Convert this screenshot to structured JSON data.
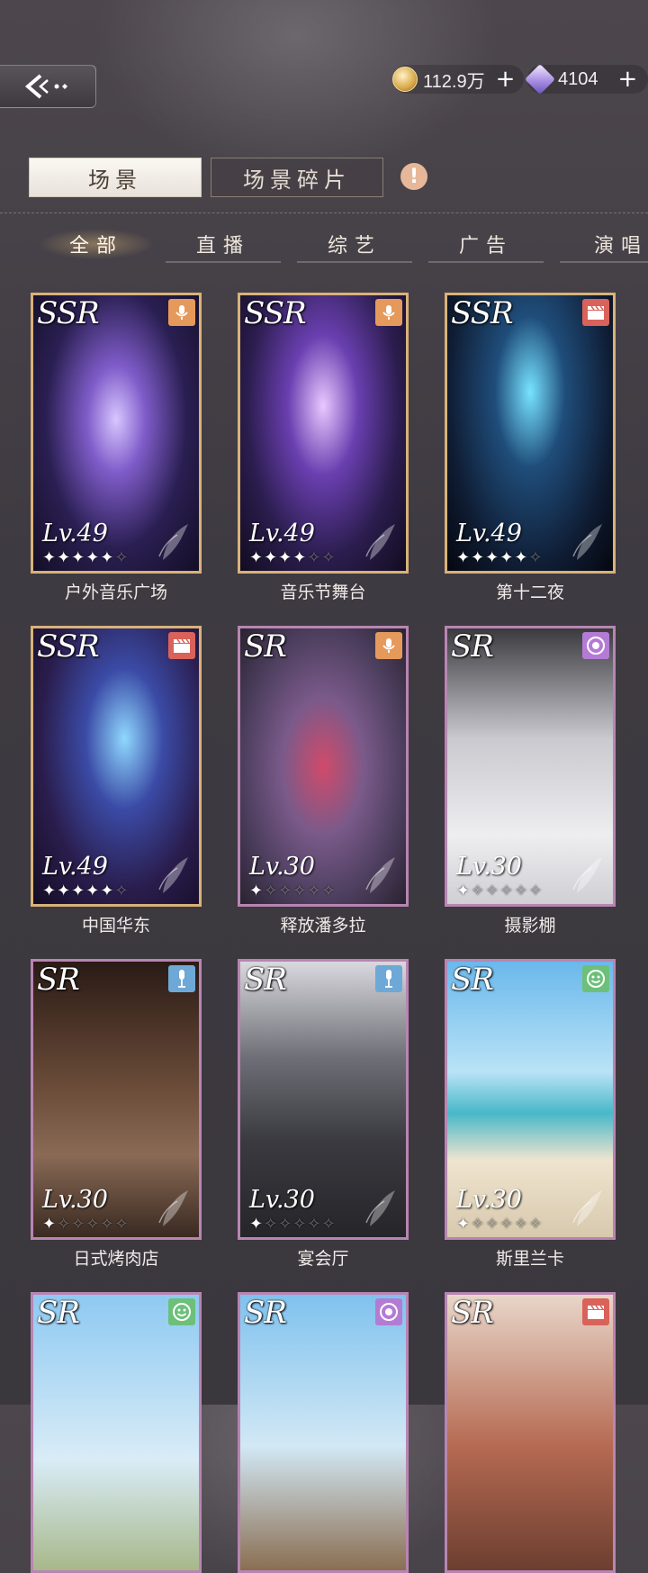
{
  "header": {
    "back_icon": "back-arrow-icon",
    "gold": {
      "icon": "coin-icon",
      "value": "112.9万",
      "plus": "+"
    },
    "gems": {
      "icon": "gem-icon",
      "value": "4104",
      "plus": "+"
    }
  },
  "tabs": {
    "scene": "场景",
    "fragments": "场景碎片"
  },
  "categories": [
    "全部",
    "直播",
    "综艺",
    "广告",
    "演唱"
  ],
  "cards": [
    {
      "name": "户外音乐广场",
      "rarity": "SSR",
      "level": "Lv.49",
      "stars": 5,
      "type": "microphone-icon",
      "type_color": "#e59a5c"
    },
    {
      "name": "音乐节舞台",
      "rarity": "SSR",
      "level": "Lv.49",
      "stars": 4,
      "type": "microphone-icon",
      "type_color": "#e59a5c"
    },
    {
      "name": "第十二夜",
      "rarity": "SSR",
      "level": "Lv.49",
      "stars": 5,
      "type": "clapperboard-icon",
      "type_color": "#d9625a"
    },
    {
      "name": "中国华东",
      "rarity": "SSR",
      "level": "Lv.49",
      "stars": 5,
      "type": "clapperboard-icon",
      "type_color": "#d9625a"
    },
    {
      "name": "释放潘多拉",
      "rarity": "SR",
      "level": "Lv.30",
      "stars": 1,
      "type": "microphone-icon",
      "type_color": "#e59a5c"
    },
    {
      "name": "摄影棚",
      "rarity": "SR",
      "level": "Lv.30",
      "stars": 1,
      "type": "camera-lens-icon",
      "type_color": "#b47bd4"
    },
    {
      "name": "日式烤肉店",
      "rarity": "SR",
      "level": "Lv.30",
      "stars": 1,
      "type": "microphone-stand-icon",
      "type_color": "#6ea8d6"
    },
    {
      "name": "宴会厅",
      "rarity": "SR",
      "level": "Lv.30",
      "stars": 1,
      "type": "microphone-stand-icon",
      "type_color": "#6ea8d6"
    },
    {
      "name": "斯里兰卡",
      "rarity": "SR",
      "level": "Lv.30",
      "stars": 1,
      "type": "smiley-icon",
      "type_color": "#6cc07a"
    },
    {
      "name": "",
      "rarity": "SR",
      "level": "",
      "stars": 0,
      "type": "smiley-icon",
      "type_color": "#6cc07a"
    },
    {
      "name": "",
      "rarity": "SR",
      "level": "",
      "stars": 0,
      "type": "camera-lens-icon",
      "type_color": "#b47bd4"
    },
    {
      "name": "",
      "rarity": "SR",
      "level": "",
      "stars": 0,
      "type": "clapperboard-icon",
      "type_color": "#d9625a"
    }
  ]
}
